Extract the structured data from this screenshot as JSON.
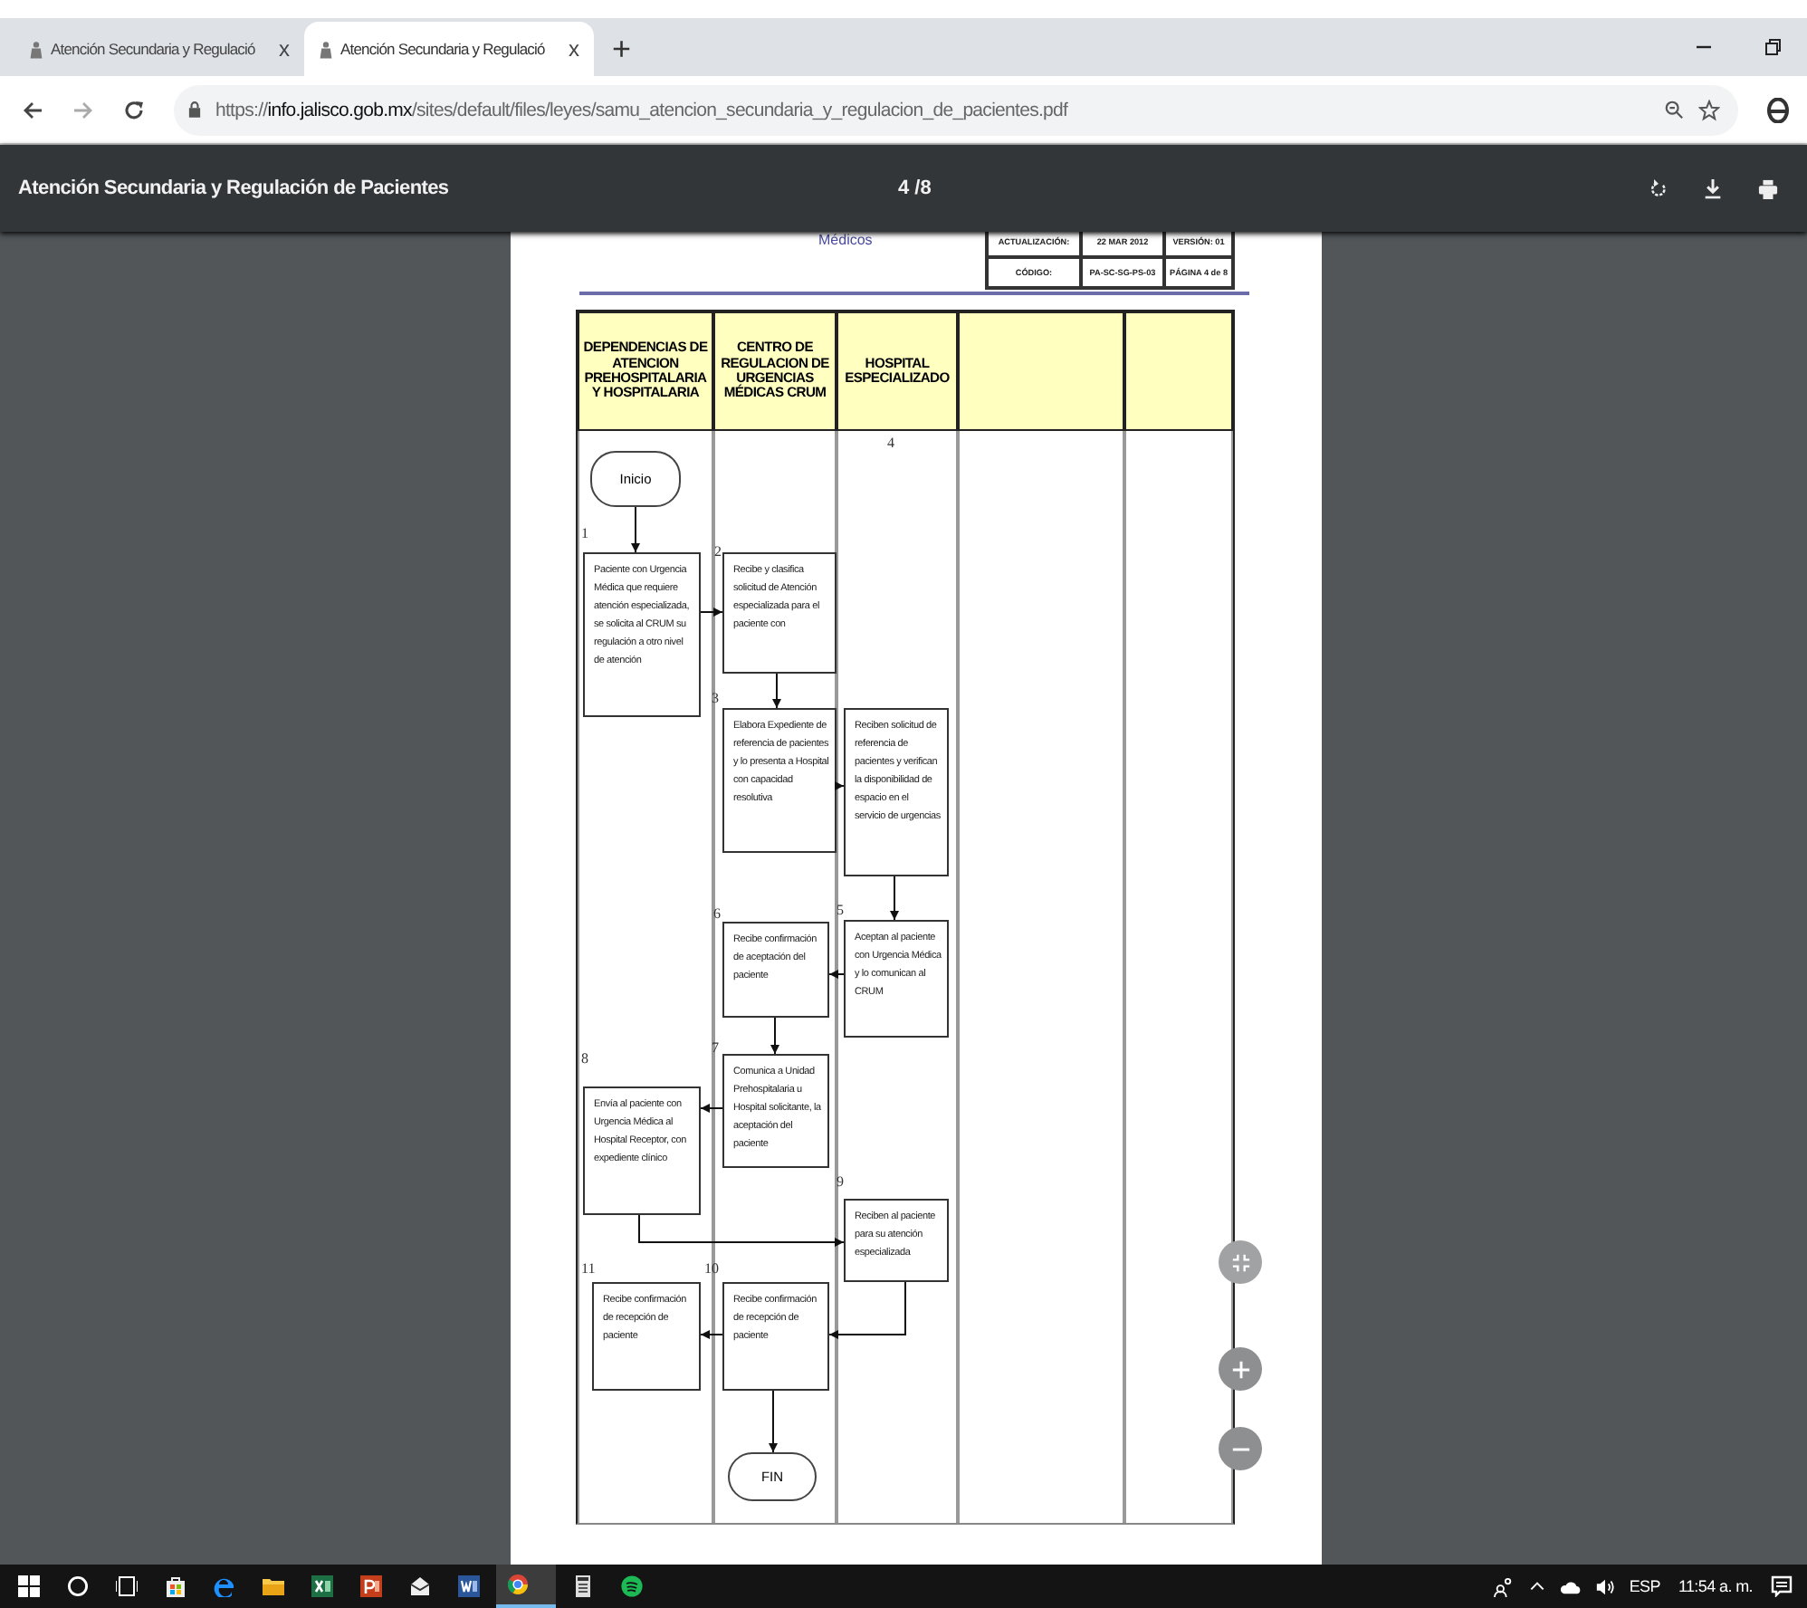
{
  "tabs": [
    {
      "title": "Atención Secundaria y Regulació",
      "close": "x",
      "selected": false
    },
    {
      "title": "Atención Secundaria y Regulació",
      "close": "x",
      "selected": true
    }
  ],
  "new_tab": "+",
  "address_bar": {
    "scheme": "https://",
    "host": "info.jalisco.gob.mx",
    "path": "/sites/default/files/leyes/samu_atencion_secundaria_y_regulacion_de_pacientes.pdf"
  },
  "pdf_toolbar": {
    "title": "Atención Secundaria y Regulación de Pacientes",
    "page": "4 /8"
  },
  "document": {
    "header_fragment": "Médicos",
    "header_table": [
      [
        "ACTUALIZACIÓN:",
        "22 MAR 2012",
        "VERSIÓN: 01"
      ],
      [
        "CÓDIGO:",
        "PA-SC-SG-PS-03",
        "PÁGINA 4 de 8"
      ]
    ],
    "lanes": [
      {
        "kind": "titled",
        "title": "DEPENDENCIAS DE ATENCION PREHOSPITALARIA Y HOSPITALARIA"
      },
      {
        "kind": "titled",
        "title": "CENTRO DE REGULACION DE URGENCIAS MÉDICAS CRUM"
      },
      {
        "kind": "titled",
        "title": "HOSPITAL ESPECIALIZADO"
      },
      {
        "kind": "blank"
      },
      {
        "kind": "blank"
      }
    ],
    "nodes": [
      {
        "kind": "terminal",
        "text": "Inicio"
      },
      {
        "kind": "process",
        "number": "1",
        "text": "Paciente con Urgencia Médica que requiere atención especializada, se solicita al CRUM su regulación a otro nivel de atención"
      },
      {
        "kind": "process",
        "number": "2",
        "text": "Recibe y clasifica solicitud de Atención especializada para el paciente con"
      },
      {
        "kind": "process",
        "number": "3",
        "text": "Elabora Expediente de referencia de pacientes y lo presenta a Hospital con capacidad resolutiva"
      },
      {
        "kind": "process",
        "number": "4",
        "text": "Reciben solicitud de referencia de pacientes y verifican la disponibilidad de espacio en el servicio de urgencias"
      },
      {
        "kind": "process",
        "number": "6",
        "text": "Recibe confirmación de aceptación del paciente"
      },
      {
        "kind": "process",
        "number": "5",
        "text": "Aceptan al paciente con Urgencia Médica y lo comunican al CRUM"
      },
      {
        "kind": "process",
        "number": "7",
        "text": "Comunica a Unidad Prehospitalaria u Hospital solicitante, la aceptación del paciente"
      },
      {
        "kind": "process",
        "number": "8",
        "text": "Envía al paciente con Urgencia Médica al Hospital Receptor, con expediente clínico"
      },
      {
        "kind": "process",
        "number": "9",
        "text": "Reciben al paciente para su atención especializada"
      },
      {
        "kind": "process",
        "number": "11",
        "text": "Recibe confirmación de recepción de paciente"
      },
      {
        "kind": "process",
        "number": "10",
        "text": "Recibe confirmación de recepción de paciente"
      },
      {
        "kind": "terminal",
        "text": "FIN"
      }
    ]
  },
  "taskbar": {
    "language": "ESP",
    "time": "11:54 a. m."
  }
}
